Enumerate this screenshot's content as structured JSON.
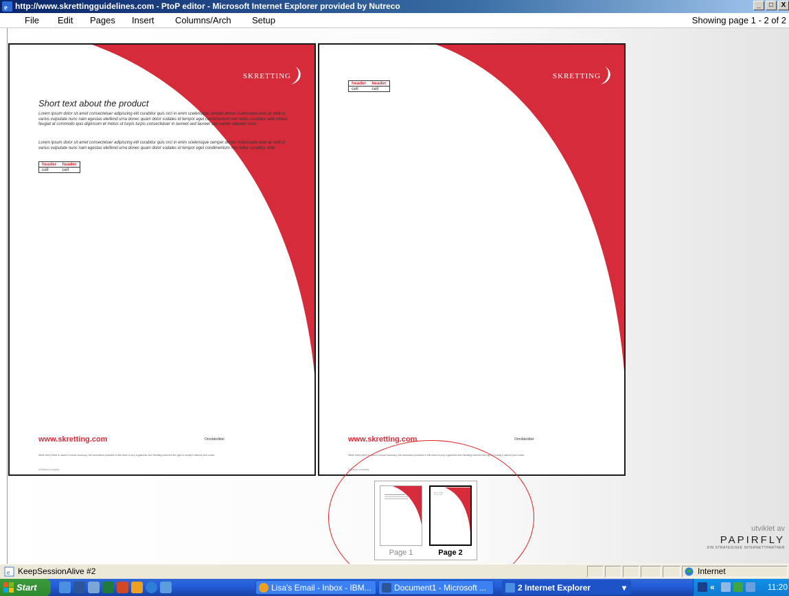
{
  "window": {
    "title": "http://www.skrettingguidelines.com - PtoP editor - Microsoft Internet Explorer provided by Nutreco",
    "minimize": "_",
    "maximize": "□",
    "close": "X"
  },
  "menu": {
    "items": [
      "File",
      "Edit",
      "Pages",
      "Insert",
      "Columns/Arch",
      "Setup"
    ],
    "showing": "Showing page 1 - 2 of 2"
  },
  "pages": [
    {
      "logo": "SKRETTING",
      "title": "Short text about the product",
      "paragraph1": "Lorem ipsum dolor sit amet consectetuer adipiscing elit curabitur quis orci in enim scelerisque semper donec malesuada ante ac velit ut varius vulputate nunc nam egestas eleifend urna donec quam dolor sodales id tempor eget condimentum non tellus curabitur ante metus feugiat at commodo quis dignissim et metus ut turpis turpis consectetuer in laoreet sed laoreet sed sapien aliquam nunc",
      "paragraph2": "Lorem ipsum dolor sit amet consectetuer adipiscing elit curabitur quis orci in enim scelerisque semper donec malesuada ante ac velit ut varius vulputate nunc nam egestas eleifend urna donec quam dolor sodales id tempor eget condimentum non tellus curabitur ante",
      "table": {
        "headers": [
          "header",
          "header"
        ],
        "cells": [
          "cell",
          "cell"
        ]
      },
      "website": "www.skretting.com",
      "omr": "Område/tittel",
      "fine_print": "While every effort is made to ensure accuracy, the information provided in this sheet is only a guideline and Skretting reserves the right to modify it without prior notice.",
      "company": "a Nutreco company"
    },
    {
      "logo": "SKRETTING",
      "table": {
        "headers": [
          "header",
          "header"
        ],
        "cells": [
          "cell",
          "cell"
        ]
      },
      "website": "www.skretting.com",
      "omr": "Område/tittel",
      "fine_print": "While every effort is made to ensure accuracy, the information provided in this sheet is only a guideline and Skretting reserves the right to modify it without prior notice.",
      "company": "a Nutreco company"
    }
  ],
  "thumbnails": {
    "labels": [
      "Page 1",
      "Page 2"
    ],
    "active": "Page 2"
  },
  "branding": {
    "developed_by": "utviklet av",
    "name": "PAPIRFLY",
    "tagline": "DIN STRATEGISKE INTERNETTPARTNER"
  },
  "status_bar": {
    "text": "KeepSessionAlive #2",
    "zone": "Internet"
  },
  "taskbar": {
    "start": "Start",
    "tasks": [
      "Lisa's Email - Inbox - IBM...",
      "Document1 - Microsoft ...",
      "2 Internet Explorer"
    ],
    "task_dropdown": "▾",
    "tray_collapse": "«",
    "clock": "11:20"
  },
  "colors": {
    "brand_red": "#d52b3a",
    "title_blue": "#0a246a",
    "taskbar_blue": "#245edb",
    "start_green": "#3c9a3c"
  }
}
